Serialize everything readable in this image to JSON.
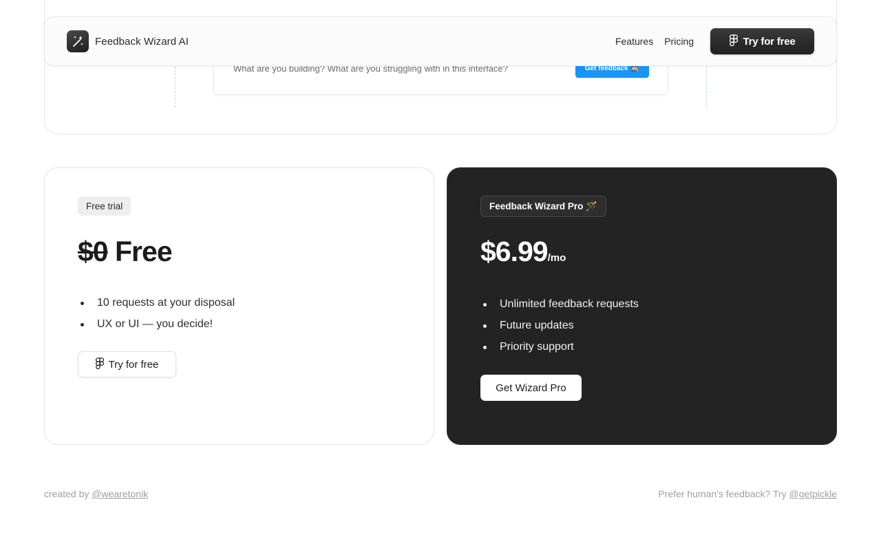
{
  "preview": {
    "prompt_placeholder": "What are you building? What are you struggling with in this interface?",
    "get_feedback_label": "Get feedback",
    "get_feedback_emoji": "🧙"
  },
  "navbar": {
    "brand": "Feedback Wizard AI",
    "links": [
      "Features",
      "Pricing"
    ],
    "cta_label": "Try for free"
  },
  "pricing": {
    "free": {
      "badge": "Free trial",
      "price_old": "$0",
      "price": "Free",
      "features": [
        "10 requests at your disposal",
        "UX or UI — you decide!"
      ],
      "cta_label": "Try for free"
    },
    "pro": {
      "badge": "Feedback Wizard Pro",
      "badge_emoji": "🪄",
      "price": "$6.99",
      "period": "/mo",
      "features": [
        "Unlimited feedback requests",
        "Future updates",
        "Priority support"
      ],
      "cta_label": "Get Wizard Pro"
    }
  },
  "footer": {
    "left_prefix": "created by ",
    "left_link": "@wearetonik",
    "right_prefix": "Prefer human's feedback? Try ",
    "right_link": "@getpickle"
  },
  "colors": {
    "accent_blue": "#1a95f2",
    "dark_card": "#232323",
    "nav_button": "#2a2a2a"
  }
}
